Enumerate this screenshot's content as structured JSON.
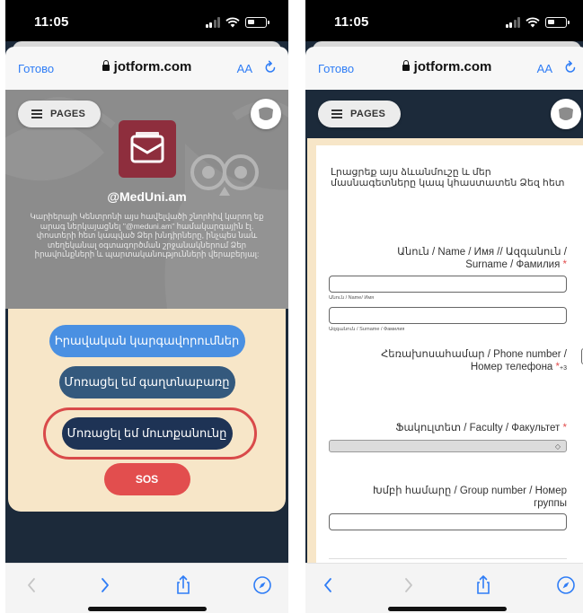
{
  "status": {
    "time": "11:05"
  },
  "browser": {
    "done_label": "Готово",
    "url": "jotform.com",
    "text_size_label": "AA"
  },
  "left": {
    "pages_label": "PAGES",
    "handle": "@MedUni.am",
    "description": "Կարիերայի Կենտրոնի այս հավելվածի շնորհիվ կարող եք արագ ներկայացնել \"@meduni.am\" համակարգային էլ. փոստերի հետ կապված Ձեր խնդիրները, ինչպես նաև տեղեկանալ օգտագործման շրջանակներում Ձեր իրավունքների և պարտականությունների վերաբերյալ:",
    "buttons": {
      "law": "Իրավական կարգավորումներ",
      "password": "Մոռացել եմ գաղտնաբառը",
      "login": "Մոռացել եմ մուտքանունը",
      "sos": "SOS"
    }
  },
  "right": {
    "pages_label": "PAGES",
    "intro": "Լրացրեք այս ձևանմուշը և մեր մասնագետները կապ կհաստատեն Ձեզ հետ",
    "name_label_1": "Անուն / Name / Имя // Ազգանուն /",
    "name_label_2": "Surname / Фамилия",
    "star": "*",
    "name_sub": "Անուն / Name/ Имя",
    "surname_sub": "Ազգանուն / Surname / Фамилия",
    "phone_label_1": "Հեռախոսահամար / Phone number /",
    "phone_label_2": "Номер телефона",
    "phone_prefix": "+3",
    "faculty_label": "Ֆակուլտետ / Faculty / Факультет",
    "group_label_1": "Խմբի համարը / Group number / Номер",
    "group_label_2": "группы"
  },
  "colors": {
    "accent": "#2f7df6",
    "brand": "#8e2e3d",
    "panel": "#f7e6c8",
    "alert": "#e24e4e"
  },
  "icons": [
    "lock-icon",
    "reload-icon",
    "back-icon",
    "forward-icon",
    "share-icon",
    "compass-icon",
    "menu-icon",
    "shield-icon",
    "mail-logo-icon",
    "owl-icon"
  ]
}
